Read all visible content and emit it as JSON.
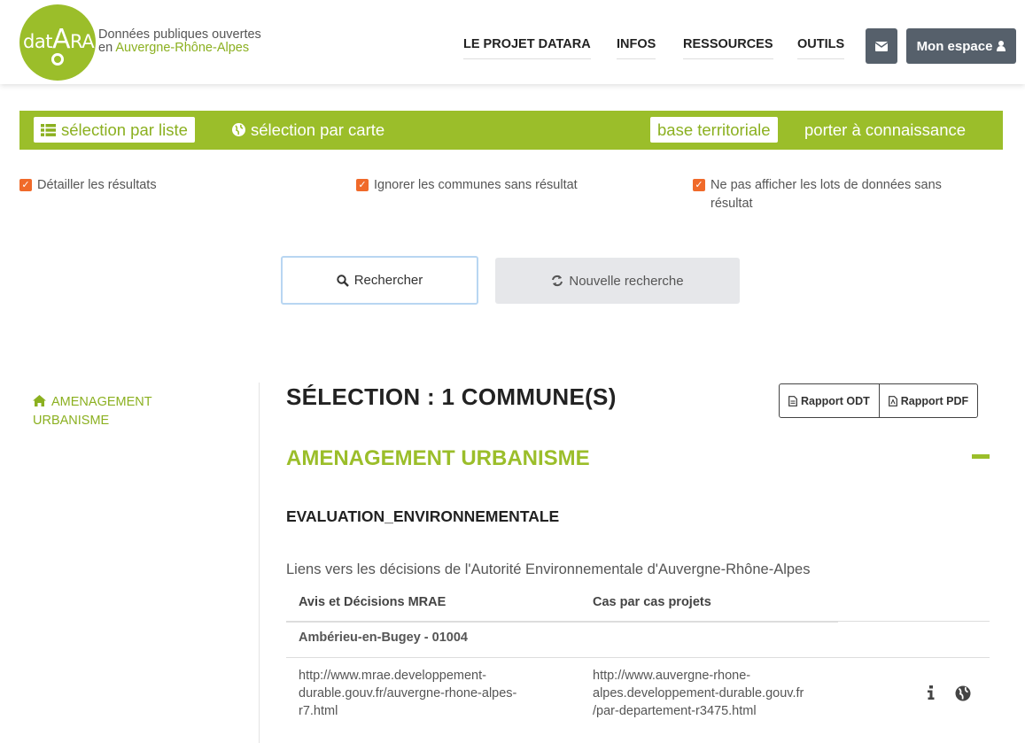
{
  "brand": {
    "logo_text": "datARA",
    "caption_line1": "Données publiques ouvertes",
    "caption_line2_prefix": "en ",
    "caption_line2_region": "Auvergne-Rhône-Alpes"
  },
  "nav": {
    "items": [
      "LE PROJET DATARA",
      "INFOS",
      "RESSOURCES",
      "OUTILS"
    ],
    "account_label": "Mon espace"
  },
  "toolbar": {
    "list_selection": "sélection par liste",
    "map_selection": "sélection par carte",
    "territorial_base": "base territoriale",
    "porter": "porter à connaissance"
  },
  "options": {
    "detail": "Détailler les résultats",
    "ignore": "Ignorer les communes sans résultat",
    "hide_empty_line1": "Ne pas afficher les lots de données sans",
    "hide_empty_line2": "résultat"
  },
  "actions": {
    "search": "Rechercher",
    "new_search": "Nouvelle recherche"
  },
  "sidebar": {
    "item_line1": "AMENAGEMENT",
    "item_line2": "URBANISME"
  },
  "main": {
    "selection_title": "SÉLECTION : 1 COMMUNE(S)",
    "report_odt": "Rapport ODT",
    "report_pdf": "Rapport PDF",
    "section_title": "AMENAGEMENT URBANISME",
    "subsection_title": "EVALUATION_ENVIRONNEMENTALE",
    "description": "Liens vers les décisions de l'Autorité Environnementale d'Auvergne-Rhône-Alpes",
    "table": {
      "headers": [
        "Avis et Décisions MRAE",
        "Cas par cas projets"
      ],
      "group": "Ambérieu-en-Bugey - 01004",
      "row": {
        "col1": [
          "http://www.mrae.developpement-",
          "durable.gouv.fr/auvergne-rhone-alpes-",
          "r7.html"
        ],
        "col2": [
          "http://www.auvergne-rhone-",
          "alpes.developpement-durable.gouv.fr",
          "/par-departement-r3475.html"
        ]
      }
    }
  },
  "colors": {
    "accent": "#9bbe2a",
    "checkbox": "#f06a2a",
    "dark_button": "#56606b"
  }
}
